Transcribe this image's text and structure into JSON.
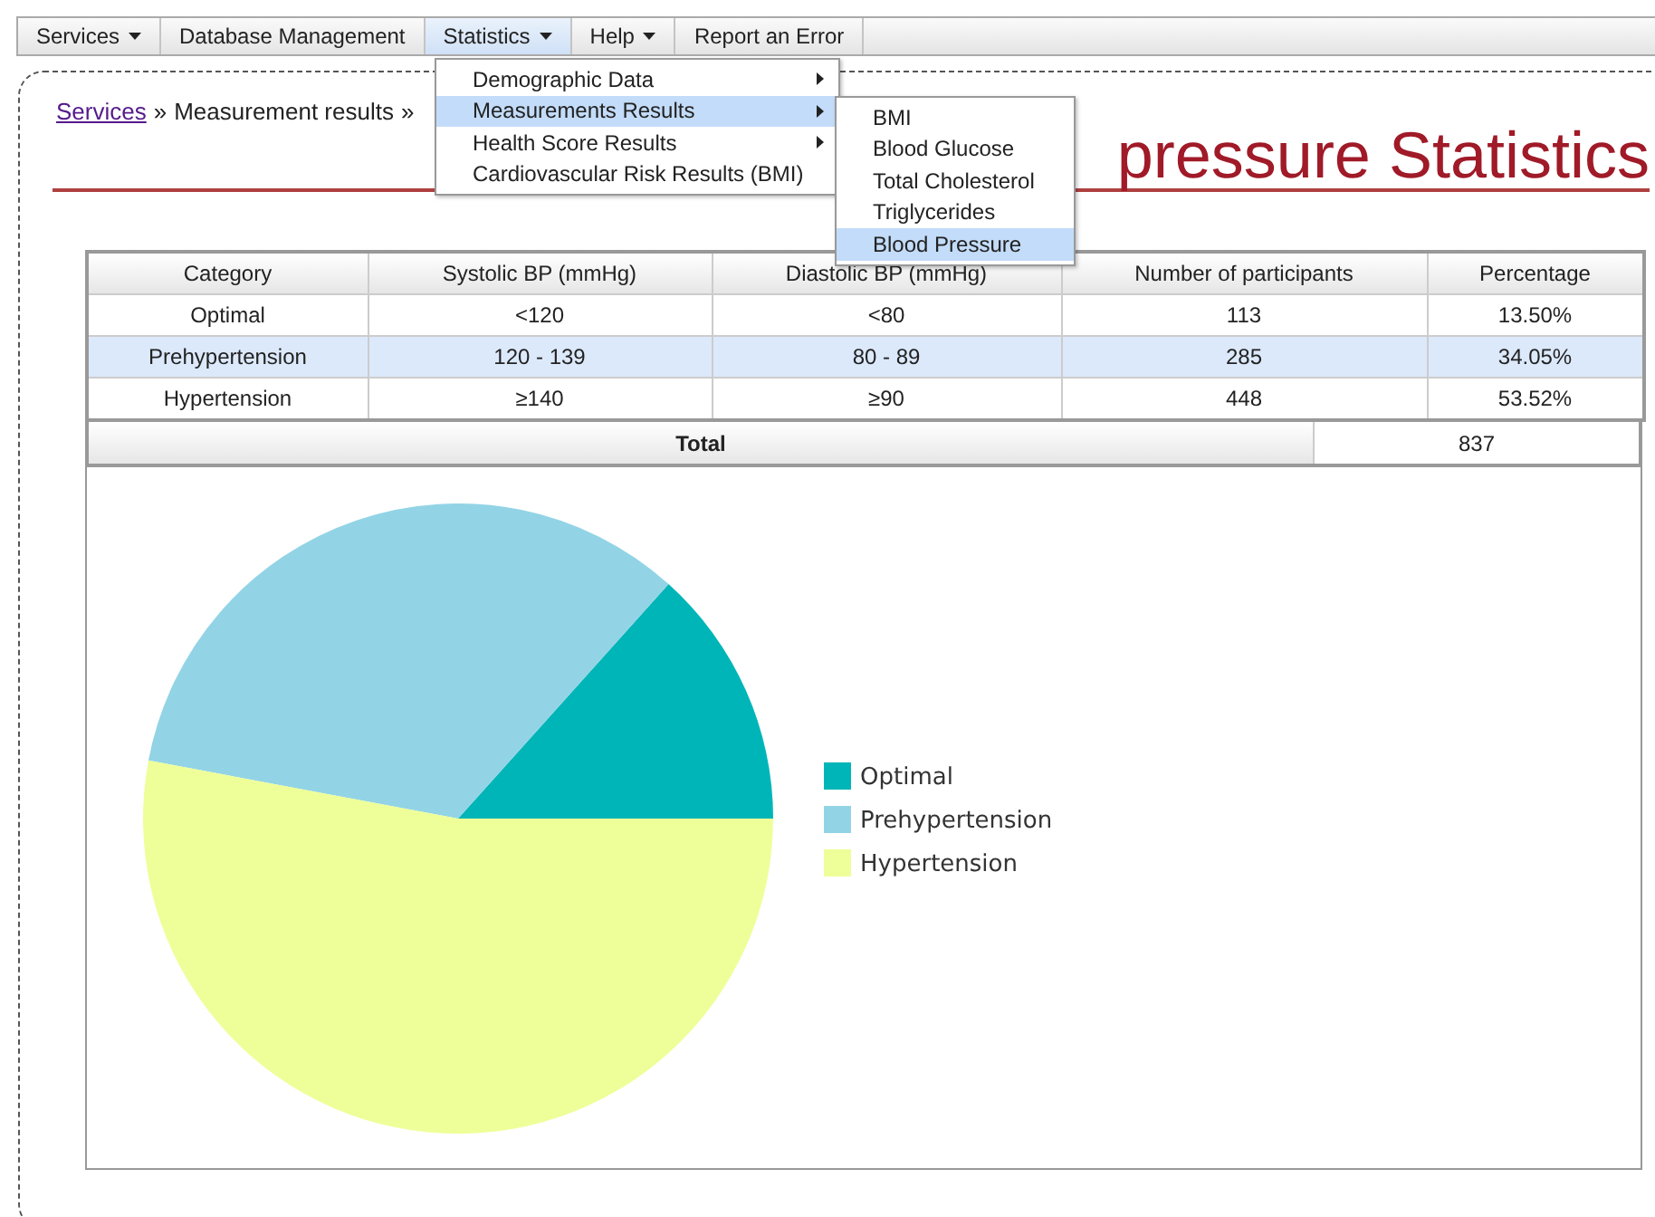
{
  "menu_bar": {
    "items": [
      {
        "label": "Services",
        "has_caret": true,
        "selected": false
      },
      {
        "label": "Database Management",
        "has_caret": false,
        "selected": false
      },
      {
        "label": "Statistics",
        "has_caret": true,
        "selected": true
      },
      {
        "label": "Help",
        "has_caret": true,
        "selected": false
      },
      {
        "label": "Report an Error",
        "has_caret": false,
        "selected": false
      }
    ]
  },
  "statistics_menu": {
    "items": [
      {
        "label": "Demographic Data",
        "has_submenu": true,
        "selected": false
      },
      {
        "label": "Measurements Results",
        "has_submenu": true,
        "selected": true
      },
      {
        "label": "Health Score Results",
        "has_submenu": true,
        "selected": false
      },
      {
        "label": "Cardiovascular Risk Results (BMI)",
        "has_submenu": false,
        "selected": false
      }
    ]
  },
  "measurements_submenu": {
    "items": [
      {
        "label": "BMI",
        "selected": false
      },
      {
        "label": "Blood Glucose",
        "selected": false
      },
      {
        "label": "Total Cholesterol",
        "selected": false
      },
      {
        "label": "Triglycerides",
        "selected": false
      },
      {
        "label": "Blood Pressure",
        "selected": true
      }
    ]
  },
  "breadcrumb": {
    "link": "Services",
    "separator": "»",
    "current": "Measurement results",
    "trailing": "»"
  },
  "page_title": "pressure Statistics",
  "table": {
    "columns": [
      "Category",
      "Systolic BP (mmHg)",
      "Diastolic BP (mmHg)",
      "Number of participants",
      "Percentage"
    ],
    "rows": [
      {
        "cells": [
          "Optimal",
          "<120",
          "<80",
          "113",
          "13.50%"
        ],
        "highlighted": false
      },
      {
        "cells": [
          "Prehypertension",
          "120 - 139",
          "80 - 89",
          "285",
          "34.05%"
        ],
        "highlighted": true
      },
      {
        "cells": [
          "Hypertension",
          "≥140",
          "≥90",
          "448",
          "53.52%"
        ],
        "highlighted": false
      }
    ],
    "total": {
      "label": "Total",
      "value": "837"
    }
  },
  "chart": {
    "chart_data": {
      "type": "pie",
      "categories": [
        "Optimal",
        "Prehypertension",
        "Hypertension"
      ],
      "series": [
        {
          "values": [
            13.5,
            34.05,
            53.52
          ]
        }
      ],
      "legend": true,
      "colors": [
        "#00b5b8",
        "#92d4e6",
        "#eeff99"
      ]
    }
  }
}
